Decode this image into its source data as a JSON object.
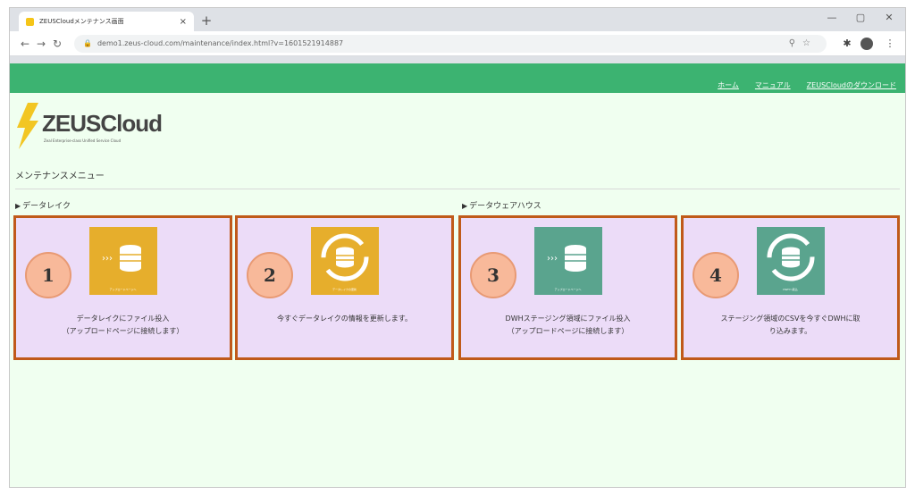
{
  "browser": {
    "tab_title": "ZEUSCloudメンテナンス画面",
    "tab_close": "×",
    "new_tab": "+",
    "window_controls": [
      "—",
      "▢",
      "✕"
    ],
    "url": "demo1.zeus-cloud.com/maintenance/index.html?v=1601521914887"
  },
  "header": {
    "links": [
      "ホーム",
      "マニュアル",
      "ZEUSCloudのダウンロード"
    ]
  },
  "logo": {
    "text": "ZEUSCloud",
    "tagline": "Zeal Enterprise-class Unified Service Cloud"
  },
  "menu_title": "メンテナンスメニュー",
  "sections": [
    {
      "label": "データレイク"
    },
    {
      "label": "データウェアハウス"
    }
  ],
  "cards": [
    {
      "number": "1",
      "icon": "database-upload-icon",
      "tile_color": "#e6ae2c",
      "tile_caption": "アップロードページへ",
      "line1": "データレイクにファイル投入",
      "line2": "（アップロードページに接続します）"
    },
    {
      "number": "2",
      "icon": "database-refresh-icon",
      "tile_color": "#e6ae2c",
      "tile_caption": "データレイクの更新",
      "line1": "今すぐデータレイクの情報を更新します。",
      "line2": ""
    },
    {
      "number": "3",
      "icon": "database-upload-icon",
      "tile_color": "#5aa48e",
      "tile_caption": "アップロードページへ",
      "line1": "DWHステージング領域にファイル投入",
      "line2": "（アップロードページに接続します）"
    },
    {
      "number": "4",
      "icon": "database-refresh-icon",
      "tile_color": "#5aa48e",
      "tile_caption": "DWHへ取込",
      "line1": "ステージング領域のCSVを今すぐDWHに取",
      "line2": "り込みます。"
    }
  ],
  "colors": {
    "header_green": "#3cb371",
    "page_bg": "#f0fff0",
    "card_border": "#c05a1a",
    "card_bg": "#ecdcf8",
    "badge": "#f8b99a"
  }
}
